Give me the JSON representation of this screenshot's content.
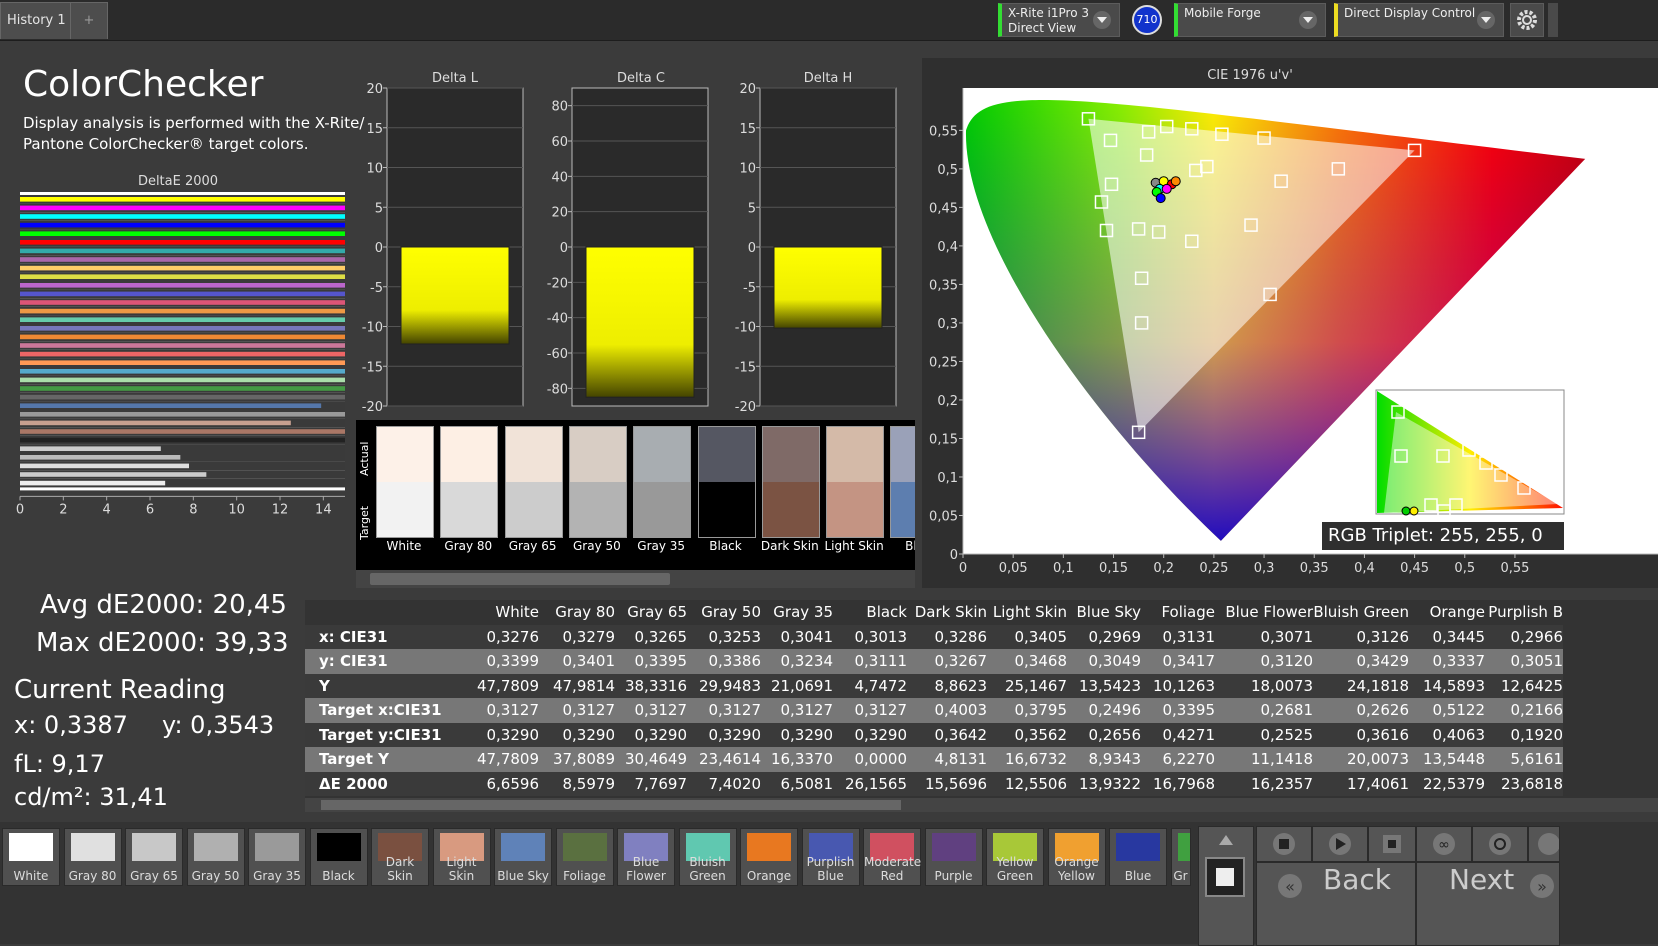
{
  "top": {
    "tab_label": "History 1",
    "tab_add": "+",
    "device1_line1": "X-Rite i1Pro 3",
    "device1_line2": "Direct View",
    "device_badge": "710",
    "device2": "Mobile Forge",
    "device3": "Direct Display Control",
    "icons": {
      "settings": "gear-icon"
    }
  },
  "header": {
    "title": "ColorChecker",
    "desc_line1": "Display analysis is performed with the X-Rite/",
    "desc_line2": "Pantone ColorChecker® target colors."
  },
  "de_chart": {
    "title": "DeltaE 2000",
    "ticks": [
      "0",
      "2",
      "4",
      "6",
      "8",
      "10",
      "12",
      "14"
    ],
    "xmax": 15,
    "bars": [
      {
        "color": "#ffff00",
        "value": 15
      },
      {
        "color": "#ff00ff",
        "value": 15
      },
      {
        "color": "#00ffff",
        "value": 15
      },
      {
        "color": "#0000ff",
        "value": 15
      },
      {
        "color": "#00ff00",
        "value": 15
      },
      {
        "color": "#ff0000",
        "value": 15
      },
      {
        "color": "#33aaaa",
        "value": 15
      },
      {
        "color": "#aa66aa",
        "value": 15
      },
      {
        "color": "#ffcc66",
        "value": 15
      },
      {
        "color": "#dddd44",
        "value": 15
      },
      {
        "color": "#bb66cc",
        "value": 15
      },
      {
        "color": "#5555cc",
        "value": 15
      },
      {
        "color": "#dd5577",
        "value": 15
      },
      {
        "color": "#ee9944",
        "value": 15
      },
      {
        "color": "#66ccaa",
        "value": 15
      },
      {
        "color": "#7777bb",
        "value": 15
      },
      {
        "color": "#ee8833",
        "value": 15
      },
      {
        "color": "#cc7799",
        "value": 15
      },
      {
        "color": "#ee6666",
        "value": 15
      },
      {
        "color": "#ff9955",
        "value": 15
      },
      {
        "color": "#55aacc",
        "value": 15
      },
      {
        "color": "#aaddaa",
        "value": 15
      },
      {
        "color": "#449944",
        "value": 15
      },
      {
        "color": "#666666",
        "value": 15
      },
      {
        "color": "#5577aa",
        "value": 13.9
      },
      {
        "color": "#999999",
        "value": 15
      },
      {
        "color": "#c8a090",
        "value": 12.5
      },
      {
        "color": "#aa7766",
        "value": 15.6
      },
      {
        "color": "#222222",
        "value": 15
      },
      {
        "color": "#cccccc",
        "value": 6.5
      },
      {
        "color": "#bbbbbb",
        "value": 7.4
      },
      {
        "color": "#dddddd",
        "value": 7.8
      },
      {
        "color": "#cccccc",
        "value": 8.6
      },
      {
        "color": "#eeeeee",
        "value": 6.7
      }
    ]
  },
  "delta_l": {
    "title": "Delta L",
    "ticks": [
      "20",
      "15",
      "10",
      "5",
      "0",
      "-5",
      "-10",
      "-15",
      "-20"
    ],
    "min": -20,
    "max": 20,
    "value": -12.2
  },
  "delta_c": {
    "title": "Delta C",
    "ticks": [
      "80",
      "60",
      "40",
      "20",
      "0",
      "-20",
      "-40",
      "-60",
      "-80"
    ],
    "min": -90,
    "max": 90,
    "value": -85
  },
  "delta_h": {
    "title": "Delta H",
    "ticks": [
      "20",
      "15",
      "10",
      "5",
      "0",
      "-5",
      "-10",
      "-15",
      "-20"
    ],
    "min": -20,
    "max": 20,
    "value": -10.2
  },
  "patches": {
    "label_actual": "Actual",
    "label_target": "Target",
    "items": [
      {
        "name": "White",
        "actual": "#fdf1e8",
        "target": "#f2f2f2"
      },
      {
        "name": "Gray 80",
        "actual": "#fdefe4",
        "target": "#d9d9d9"
      },
      {
        "name": "Gray 65",
        "actual": "#f1e3d8",
        "target": "#cccccc"
      },
      {
        "name": "Gray 50",
        "actual": "#d8cdc4",
        "target": "#b3b3b3"
      },
      {
        "name": "Gray 35",
        "actual": "#a8adb1",
        "target": "#999999"
      },
      {
        "name": "Black",
        "actual": "#555762",
        "target": "#000000"
      },
      {
        "name": "Dark Skin",
        "actual": "#7f6a67",
        "target": "#7b5343"
      },
      {
        "name": "Light Skin",
        "actual": "#d4baa8",
        "target": "#c49483"
      },
      {
        "name": "Blue",
        "actual": "#9aa1b8",
        "target": "#5d7eaf"
      }
    ]
  },
  "cie": {
    "title": "CIE 1976 u'v'",
    "xticks": [
      "0",
      "0,05",
      "0,1",
      "0,15",
      "0,2",
      "0,25",
      "0,3",
      "0,35",
      "0,4",
      "0,45",
      "0,5",
      "0,55"
    ],
    "yticks": [
      "0,55",
      "0,5",
      "0,45",
      "0,4",
      "0,35",
      "0,3",
      "0,25",
      "0,2",
      "0,15",
      "0,1",
      "0,05",
      "0"
    ],
    "targets": [
      [
        0.125,
        0.565
      ],
      [
        0.147,
        0.537
      ],
      [
        0.185,
        0.548
      ],
      [
        0.203,
        0.555
      ],
      [
        0.228,
        0.552
      ],
      [
        0.258,
        0.545
      ],
      [
        0.3,
        0.54
      ],
      [
        0.45,
        0.524
      ],
      [
        0.183,
        0.518
      ],
      [
        0.232,
        0.498
      ],
      [
        0.243,
        0.503
      ],
      [
        0.148,
        0.48
      ],
      [
        0.317,
        0.484
      ],
      [
        0.374,
        0.5
      ],
      [
        0.138,
        0.457
      ],
      [
        0.143,
        0.42
      ],
      [
        0.175,
        0.422
      ],
      [
        0.195,
        0.418
      ],
      [
        0.228,
        0.406
      ],
      [
        0.287,
        0.427
      ],
      [
        0.178,
        0.358
      ],
      [
        0.306,
        0.337
      ],
      [
        0.178,
        0.3
      ],
      [
        0.175,
        0.158
      ]
    ],
    "actuals": [
      [
        0.192,
        0.482,
        "#888888"
      ],
      [
        0.2,
        0.484,
        "#ffff00"
      ],
      [
        0.208,
        0.48,
        "#ff0000"
      ],
      [
        0.196,
        0.474,
        "#00ffff"
      ],
      [
        0.203,
        0.474,
        "#ff00ff"
      ],
      [
        0.193,
        0.47,
        "#00ff00"
      ],
      [
        0.197,
        0.462,
        "#0000ff"
      ],
      [
        0.212,
        0.484,
        "#ff8800"
      ]
    ],
    "rgb_triplet": "RGB Triplet: 255, 255, 0"
  },
  "stats": {
    "avg": "Avg dE2000: 20,45",
    "max": "Max dE2000: 39,33",
    "current_title": "Current Reading",
    "x": "x: 0,3387",
    "y": "y: 0,3543",
    "fl": "fL: 9,17",
    "cdm2": "cd/m²: 31,41"
  },
  "table": {
    "columns": [
      "White",
      "Gray 80",
      "Gray 65",
      "Gray 50",
      "Gray 35",
      "Black",
      "Dark Skin",
      "Light Skin",
      "Blue Sky",
      "Foliage",
      "Blue Flower",
      "Bluish Green",
      "Orange",
      "Purplish B"
    ],
    "rows": [
      {
        "label": "x: CIE31",
        "values": [
          "0,3276",
          "0,3279",
          "0,3265",
          "0,3253",
          "0,3041",
          "0,3013",
          "0,3286",
          "0,3405",
          "0,2969",
          "0,3131",
          "0,3071",
          "0,3126",
          "0,3445",
          "0,2966"
        ]
      },
      {
        "label": "y: CIE31",
        "values": [
          "0,3399",
          "0,3401",
          "0,3395",
          "0,3386",
          "0,3234",
          "0,3111",
          "0,3267",
          "0,3468",
          "0,3049",
          "0,3417",
          "0,3120",
          "0,3429",
          "0,3337",
          "0,3051"
        ]
      },
      {
        "label": "Y",
        "values": [
          "47,7809",
          "47,9814",
          "38,3316",
          "29,9483",
          "21,0691",
          "4,7472",
          "8,8623",
          "25,1467",
          "13,5423",
          "10,1263",
          "18,0073",
          "24,1818",
          "14,5893",
          "12,6425"
        ]
      },
      {
        "label": "Target x:CIE31",
        "values": [
          "0,3127",
          "0,3127",
          "0,3127",
          "0,3127",
          "0,3127",
          "0,3127",
          "0,4003",
          "0,3795",
          "0,2496",
          "0,3395",
          "0,2681",
          "0,2626",
          "0,5122",
          "0,2166"
        ]
      },
      {
        "label": "Target y:CIE31",
        "values": [
          "0,3290",
          "0,3290",
          "0,3290",
          "0,3290",
          "0,3290",
          "0,3290",
          "0,3642",
          "0,3562",
          "0,2656",
          "0,4271",
          "0,2525",
          "0,3616",
          "0,4063",
          "0,1920"
        ]
      },
      {
        "label": "Target Y",
        "values": [
          "47,7809",
          "37,8089",
          "30,4649",
          "23,4614",
          "16,3370",
          "0,0000",
          "4,8131",
          "16,6732",
          "8,9343",
          "6,2270",
          "11,1418",
          "20,0073",
          "13,5448",
          "5,6161"
        ]
      },
      {
        "label": "ΔE 2000",
        "values": [
          "6,6596",
          "8,5979",
          "7,7697",
          "7,4020",
          "6,5081",
          "26,1565",
          "15,5696",
          "12,5506",
          "13,9322",
          "16,7968",
          "16,2357",
          "17,4061",
          "22,5379",
          "23,6818"
        ]
      }
    ]
  },
  "swatches": [
    {
      "name": "White",
      "color": "#ffffff"
    },
    {
      "name": "Gray 80",
      "color": "#e0e0e0"
    },
    {
      "name": "Gray 65",
      "color": "#c8c8c8"
    },
    {
      "name": "Gray 50",
      "color": "#b0b0b0"
    },
    {
      "name": "Gray 35",
      "color": "#9a9a9a"
    },
    {
      "name": "Black",
      "color": "#000000"
    },
    {
      "name": "Dark Skin",
      "color": "#7a5040"
    },
    {
      "name": "Light Skin",
      "color": "#d89a80"
    },
    {
      "name": "Blue Sky",
      "color": "#5f82b8"
    },
    {
      "name": "Foliage",
      "color": "#5a7040"
    },
    {
      "name": "Blue Flower",
      "color": "#8080c0"
    },
    {
      "name": "Bluish Green",
      "color": "#60c8b0"
    },
    {
      "name": "Orange",
      "color": "#e87820"
    },
    {
      "name": "Purplish Blue",
      "color": "#4858b0"
    },
    {
      "name": "Moderate Red",
      "color": "#d05060"
    },
    {
      "name": "Purple",
      "color": "#604080"
    },
    {
      "name": "Yellow Green",
      "color": "#a8c838"
    },
    {
      "name": "Orange Yellow",
      "color": "#f0a030"
    },
    {
      "name": "Blue",
      "color": "#2838a0"
    },
    {
      "name": "Gr",
      "color": "#40a040"
    }
  ],
  "nav": {
    "back": "Back",
    "next": "Next"
  }
}
